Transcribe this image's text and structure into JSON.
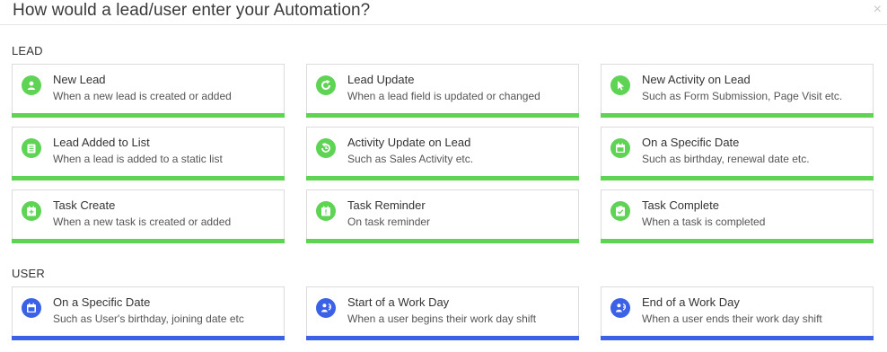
{
  "dialog": {
    "title": "How would a lead/user enter your Automation?",
    "close_glyph": "×"
  },
  "colors": {
    "lead_accent": "#5ed354",
    "user_accent": "#3b62e6"
  },
  "lead": {
    "label": "LEAD",
    "cards": [
      {
        "title": "New Lead",
        "desc": "When a new lead is created or added",
        "icon": "user-icon"
      },
      {
        "title": "Lead Update",
        "desc": "When a lead field is updated or changed",
        "icon": "refresh-icon"
      },
      {
        "title": "New Activity on Lead",
        "desc": "Such as Form Submission, Page Visit etc.",
        "icon": "cursor-icon"
      },
      {
        "title": "Lead Added to List",
        "desc": "When a lead is added to a static list",
        "icon": "list-icon"
      },
      {
        "title": "Activity Update on Lead",
        "desc": "Such as Sales Activity etc.",
        "icon": "activity-refresh-icon"
      },
      {
        "title": "On a Specific Date",
        "desc": "Such as birthday, renewal date etc.",
        "icon": "calendar-icon"
      },
      {
        "title": "Task Create",
        "desc": "When a new task is created or added",
        "icon": "task-add-icon"
      },
      {
        "title": "Task Reminder",
        "desc": "On task reminder",
        "icon": "task-reminder-icon"
      },
      {
        "title": "Task Complete",
        "desc": "When a task is completed",
        "icon": "task-complete-icon"
      }
    ]
  },
  "user": {
    "label": "USER",
    "cards": [
      {
        "title": "On a Specific Date",
        "desc": "Such as User's birthday, joining date etc",
        "icon": "calendar-icon"
      },
      {
        "title": "Start of a Work Day",
        "desc": "When a user begins their work day shift",
        "icon": "work-day-start-icon"
      },
      {
        "title": "End of a Work Day",
        "desc": "When a user ends their work day shift",
        "icon": "work-day-end-icon"
      }
    ]
  }
}
